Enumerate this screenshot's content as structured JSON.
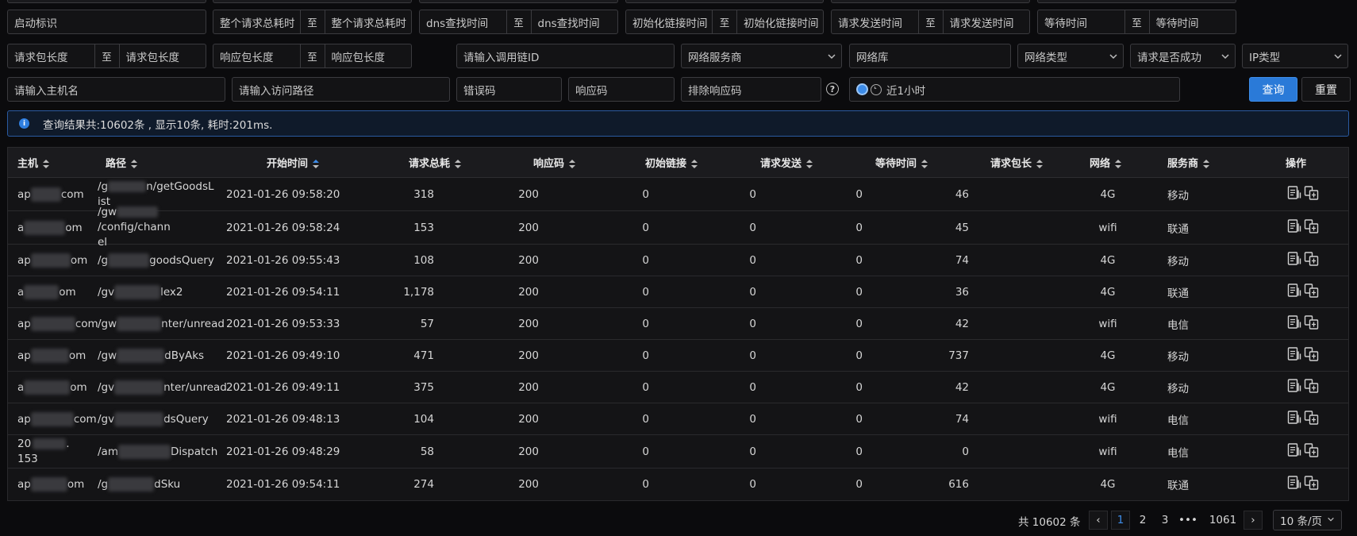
{
  "filters": {
    "row1": [
      {
        "type": "text",
        "placeholder": "启动标识"
      },
      {
        "type": "range",
        "from": "整个请求总耗时",
        "to": "整个请求总耗时",
        "sep": "至"
      },
      {
        "type": "range",
        "from": "dns查找时间",
        "to": "dns查找时间",
        "sep": "至"
      },
      {
        "type": "range",
        "from": "初始化链接时间",
        "to": "初始化链接时间",
        "sep": "至"
      },
      {
        "type": "range",
        "from": "请求发送时间",
        "to": "请求发送时间",
        "sep": "至"
      },
      {
        "type": "range",
        "from": "等待时间",
        "to": "等待时间",
        "sep": "至"
      }
    ],
    "row2": [
      {
        "type": "range",
        "from": "请求包长度",
        "to": "请求包长度",
        "sep": "至"
      },
      {
        "type": "range",
        "from": "响应包长度",
        "to": "响应包长度",
        "sep": "至"
      },
      {
        "type": "text",
        "placeholder": "请输入调用链ID"
      },
      {
        "type": "select",
        "placeholder": "网络服务商"
      },
      {
        "type": "text",
        "placeholder": "网络库"
      },
      {
        "type": "select",
        "placeholder": "网络类型"
      },
      {
        "type": "select",
        "placeholder": "请求是否成功"
      },
      {
        "type": "select",
        "placeholder": "IP类型"
      }
    ],
    "row3": [
      {
        "type": "text",
        "placeholder": "请输入主机名"
      },
      {
        "type": "text",
        "placeholder": "请输入访问路径"
      },
      {
        "type": "text",
        "placeholder": "错误码"
      },
      {
        "type": "text",
        "placeholder": "响应码"
      },
      {
        "type": "text",
        "placeholder": "排除响应码"
      }
    ],
    "help_label": "?",
    "time_range": "近1小时"
  },
  "buttons": {
    "query": "查询",
    "reset": "重置"
  },
  "alert": {
    "text": "查询结果共:10602条 , 显示10条, 耗时:201ms."
  },
  "table": {
    "columns": [
      "主机",
      "路径",
      "开始时间",
      "请求总耗",
      "响应码",
      "初始链接",
      "请求发送",
      "等待时间",
      "请求包长",
      "网络",
      "服务商",
      "操作"
    ],
    "rows": [
      {
        "host_a": "ap",
        "host_b": "com",
        "path_a": "/g",
        "path_b": "n/getGoodsL",
        "path_c": "ist",
        "time": "2021-01-26 09:58:20",
        "total": "318",
        "code": "200",
        "init": "0",
        "send": "0",
        "wait": "0",
        "len": "46",
        "net": "4G",
        "isp": "移动"
      },
      {
        "host_a": "a",
        "host_b": "om",
        "path_a": "/gw",
        "path_b": "/config/chann",
        "path_c": "el",
        "time": "2021-01-26 09:58:24",
        "total": "153",
        "code": "200",
        "init": "0",
        "send": "0",
        "wait": "0",
        "len": "45",
        "net": "wifi",
        "isp": "联通"
      },
      {
        "host_a": "ap",
        "host_b": "om",
        "path_a": "/g",
        "path_b": "goodsQuery",
        "path_c": "",
        "time": "2021-01-26 09:55:43",
        "total": "108",
        "code": "200",
        "init": "0",
        "send": "0",
        "wait": "0",
        "len": "74",
        "net": "4G",
        "isp": "移动"
      },
      {
        "host_a": "a",
        "host_b": "om",
        "path_a": "/gv",
        "path_b": "lex2",
        "path_c": "",
        "time": "2021-01-26 09:54:11",
        "total": "1,178",
        "code": "200",
        "init": "0",
        "send": "0",
        "wait": "0",
        "len": "36",
        "net": "4G",
        "isp": "联通"
      },
      {
        "host_a": "ap",
        "host_b": "com",
        "path_a": "/gw",
        "path_b": "nter/unread",
        "path_c": "",
        "time": "2021-01-26 09:53:33",
        "total": "57",
        "code": "200",
        "init": "0",
        "send": "0",
        "wait": "0",
        "len": "42",
        "net": "wifi",
        "isp": "电信"
      },
      {
        "host_a": "ap",
        "host_b": "om",
        "path_a": "/gw",
        "path_b": "dByAks",
        "path_c": "",
        "time": "2021-01-26 09:49:10",
        "total": "471",
        "code": "200",
        "init": "0",
        "send": "0",
        "wait": "0",
        "len": "737",
        "net": "4G",
        "isp": "移动"
      },
      {
        "host_a": "a",
        "host_b": "om",
        "path_a": "/gv",
        "path_b": "nter/unread",
        "path_c": "",
        "time": "2021-01-26 09:49:11",
        "total": "375",
        "code": "200",
        "init": "0",
        "send": "0",
        "wait": "0",
        "len": "42",
        "net": "4G",
        "isp": "移动"
      },
      {
        "host_a": "ap",
        "host_b": "com",
        "path_a": "/gv",
        "path_b": "dsQuery",
        "path_c": "",
        "time": "2021-01-26 09:48:13",
        "total": "104",
        "code": "200",
        "init": "0",
        "send": "0",
        "wait": "0",
        "len": "74",
        "net": "wifi",
        "isp": "电信"
      },
      {
        "host_a": "20",
        "host_b": ".",
        "host_c": "153",
        "path_a": "/am",
        "path_b": "Dispatch",
        "path_c": "",
        "time": "2021-01-26 09:48:29",
        "total": "58",
        "code": "200",
        "init": "0",
        "send": "0",
        "wait": "0",
        "len": "0",
        "net": "wifi",
        "isp": "电信"
      },
      {
        "host_a": "ap",
        "host_b": "om",
        "path_a": "/g",
        "path_b": "dSku",
        "path_c": "",
        "time": "2021-01-26 09:54:11",
        "total": "274",
        "code": "200",
        "init": "0",
        "send": "0",
        "wait": "0",
        "len": "616",
        "net": "4G",
        "isp": "联通"
      }
    ]
  },
  "pagination": {
    "total_text": "共 10602 条",
    "pages": [
      "1",
      "2",
      "3",
      "•••",
      "1061"
    ],
    "current": "1",
    "prev": "‹",
    "next": "›",
    "page_size": "10 条/页"
  },
  "colors": {
    "accent": "#2a7ad8",
    "alert_border": "#2a5aa0",
    "bg": "#0b0b0d"
  },
  "icons": [
    "info-icon",
    "question-icon",
    "clock-icon",
    "chevron-down-icon",
    "sort-icon",
    "detail-icon",
    "trace-icon"
  ]
}
